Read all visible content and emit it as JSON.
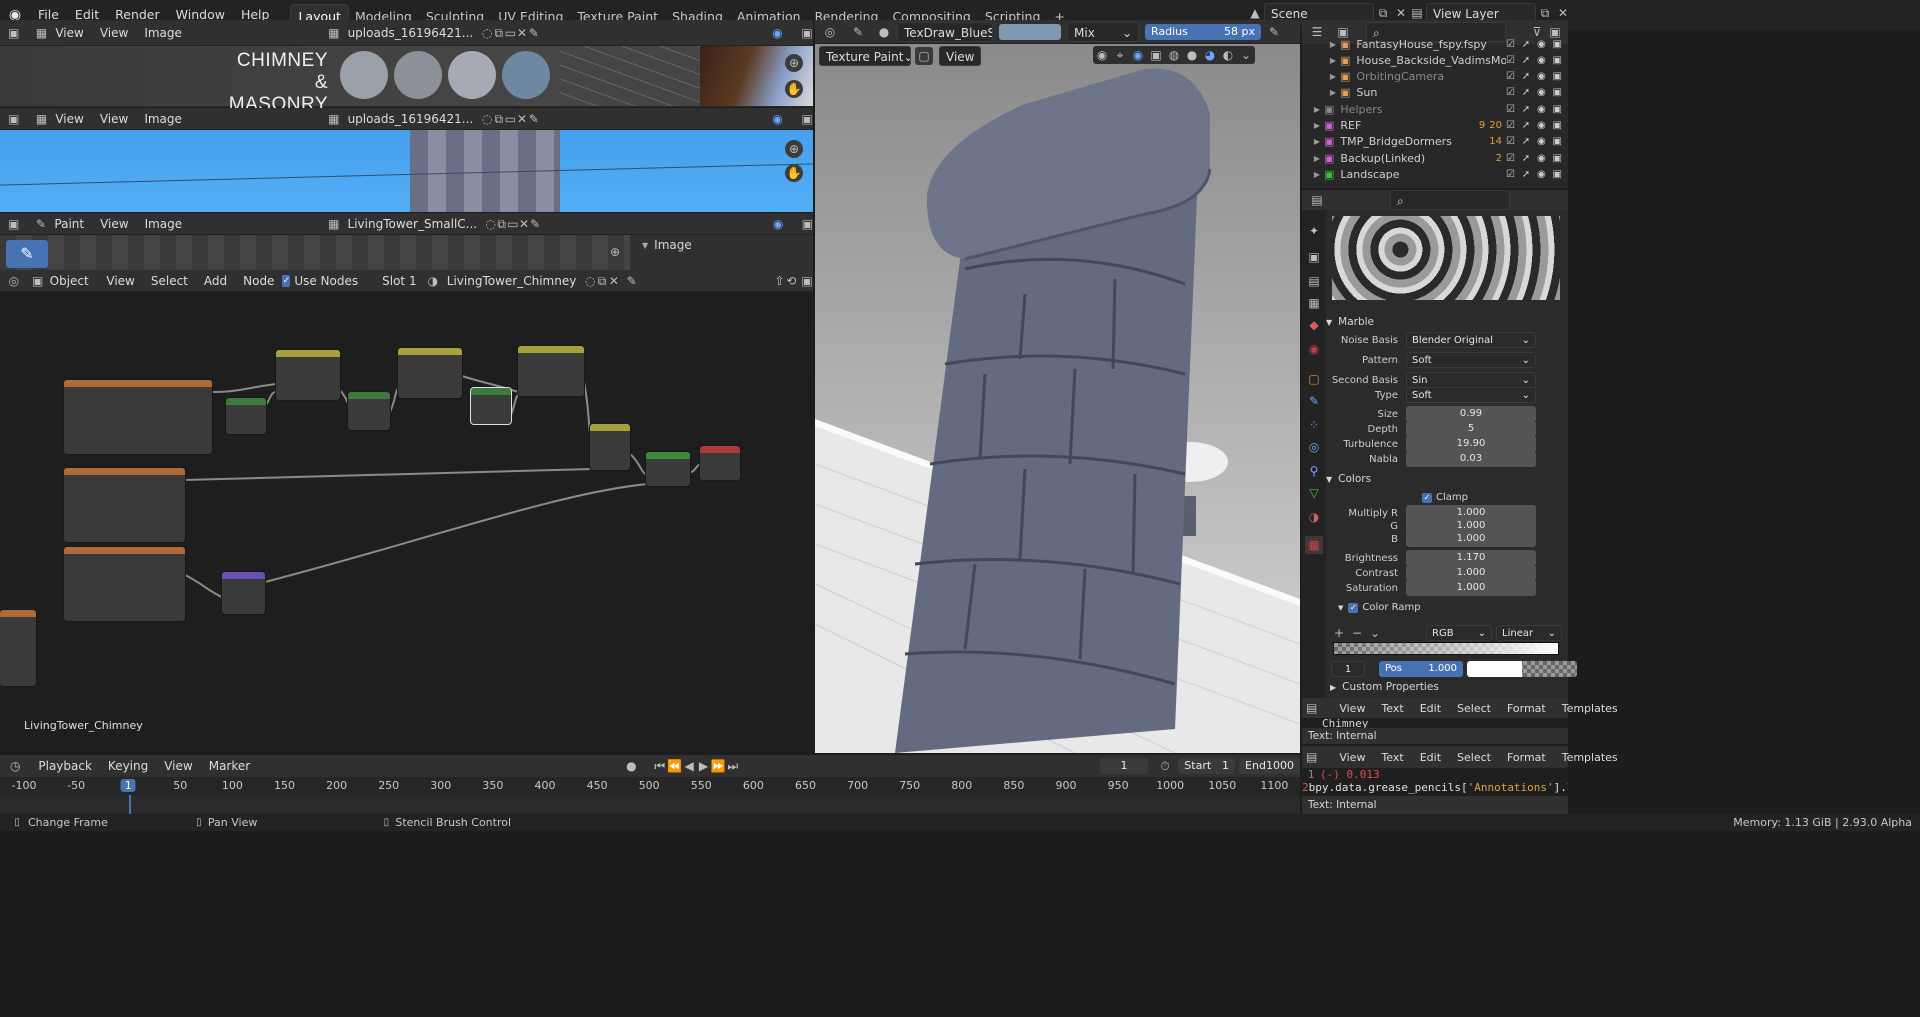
{
  "topbar": {
    "menus": [
      "File",
      "Edit",
      "Render",
      "Window",
      "Help"
    ],
    "workspaces": [
      "Layout",
      "Modeling",
      "Sculpting",
      "UV Editing",
      "Texture Paint",
      "Shading",
      "Animation",
      "Rendering",
      "Compositing",
      "Scripting"
    ],
    "active_workspace": "Layout",
    "add_tab": "+",
    "scene": "Scene",
    "view_layer": "View Layer"
  },
  "image_editor_1": {
    "mode": "View",
    "view": "View",
    "image": "Image",
    "image_name": "uploads_16196421...",
    "banner_line1": "CHIMNEY",
    "banner_line2": "& MASONRY",
    "swatches": [
      "#9aa0a8",
      "#8c9199",
      "#a8aab3",
      "#6d88a0"
    ]
  },
  "image_editor_2": {
    "mode": "View",
    "view": "View",
    "image": "Image",
    "image_name": "uploads_16196421..."
  },
  "image_editor_3": {
    "mode": "Paint",
    "view": "View",
    "image": "Image",
    "image_name": "LivingTower_SmallC...",
    "side_panel_title": "Image"
  },
  "node_editor": {
    "mode": "Object",
    "view": "View",
    "select": "Select",
    "add": "Add",
    "node": "Node",
    "use_nodes": "Use Nodes",
    "slot": "Slot 1",
    "material": "LivingTower_Chimney",
    "footer_label": "LivingTower_Chimney"
  },
  "viewport": {
    "brush": "TexDraw_BlueStone...",
    "blend": "Mix",
    "radius_label": "Radius",
    "radius_value": "58 px",
    "mode": "Texture Paint",
    "view": "View"
  },
  "outliner": {
    "search_placeholder": "",
    "items": [
      {
        "name": "FantasyHouse_fspy.fspy",
        "color": "#e0a060",
        "indent": 1
      },
      {
        "name": "House_Backside_VadimsModel",
        "color": "#e0a060",
        "indent": 1
      },
      {
        "name": "OrbitingCamera",
        "color": "#e0a060",
        "indent": 1,
        "dim": true
      },
      {
        "name": "Sun",
        "color": "#e0a060",
        "indent": 1
      },
      {
        "name": "Helpers",
        "color": "#888",
        "indent": 0,
        "dim": true
      },
      {
        "name": "REF",
        "color": "#d060d0",
        "indent": 0,
        "badge1": "9",
        "badge2": "20"
      },
      {
        "name": "TMP_BridgeDormers",
        "color": "#d060d0",
        "indent": 0,
        "badge1": "14"
      },
      {
        "name": "Backup(Linked)",
        "color": "#d060d0",
        "indent": 0,
        "badge1": "2"
      },
      {
        "name": "Landscape",
        "color": "#40c040",
        "indent": 0
      }
    ]
  },
  "properties": {
    "section_marble": "Marble",
    "noise_basis": {
      "label": "Noise Basis",
      "value": "Blender Original"
    },
    "pattern": {
      "label": "Pattern",
      "value": "Soft"
    },
    "second_basis": {
      "label": "Second Basis",
      "value": "Sin"
    },
    "type": {
      "label": "Type",
      "value": "Soft"
    },
    "size": {
      "label": "Size",
      "value": "0.99"
    },
    "depth": {
      "label": "Depth",
      "value": "5"
    },
    "turbulence": {
      "label": "Turbulence",
      "value": "19.90"
    },
    "nabla": {
      "label": "Nabla",
      "value": "0.03"
    },
    "section_colors": "Colors",
    "clamp": "Clamp",
    "multiply_r": {
      "label": "Multiply R",
      "value": "1.000"
    },
    "g": {
      "label": "G",
      "value": "1.000"
    },
    "b": {
      "label": "B",
      "value": "1.000"
    },
    "brightness": {
      "label": "Brightness",
      "value": "1.170"
    },
    "contrast": {
      "label": "Contrast",
      "value": "1.000"
    },
    "saturation": {
      "label": "Saturation",
      "value": "1.000"
    },
    "color_ramp": "Color Ramp",
    "ramp_mode": "RGB",
    "ramp_interp": "Linear",
    "ramp_index": "1",
    "ramp_pos_label": "Pos",
    "ramp_pos": "1.000",
    "custom_props": "Custom Properties"
  },
  "text_editor_1": {
    "view": "View",
    "text": "Text",
    "edit": "Edit",
    "select": "Select",
    "format": "Format",
    "templates": "Templates",
    "line1": "Chimney",
    "footer": "Text: Internal"
  },
  "text_editor_2": {
    "view": "View",
    "text": "Text",
    "edit": "Edit",
    "select": "Select",
    "format": "Format",
    "templates": "Templates",
    "ln1": "1",
    "code1": "(-) 0.013",
    "ln2": "2",
    "code2a": "bpy.data.grease_pencils[",
    "code2b": "'Annotations'",
    "code2c": "].l",
    "footer": "Text: Internal"
  },
  "timeline": {
    "playback": "Playback",
    "keying": "Keying",
    "view": "View",
    "marker": "Marker",
    "frame": "1",
    "start_label": "Start",
    "start": "1",
    "end_label": "End",
    "end": "1000",
    "ticks": [
      "-100",
      "-50",
      "1",
      "50",
      "100",
      "150",
      "200",
      "250",
      "300",
      "350",
      "400",
      "450",
      "500",
      "550",
      "600",
      "650",
      "700",
      "750",
      "800",
      "850",
      "900",
      "950",
      "1000",
      "1050",
      "1100"
    ]
  },
  "statusbar": {
    "change_frame": "Change Frame",
    "pan_view": "Pan View",
    "stencil": "Stencil Brush Control",
    "memory": "Memory: 1.13 GiB | 2.93.0 Alpha"
  }
}
